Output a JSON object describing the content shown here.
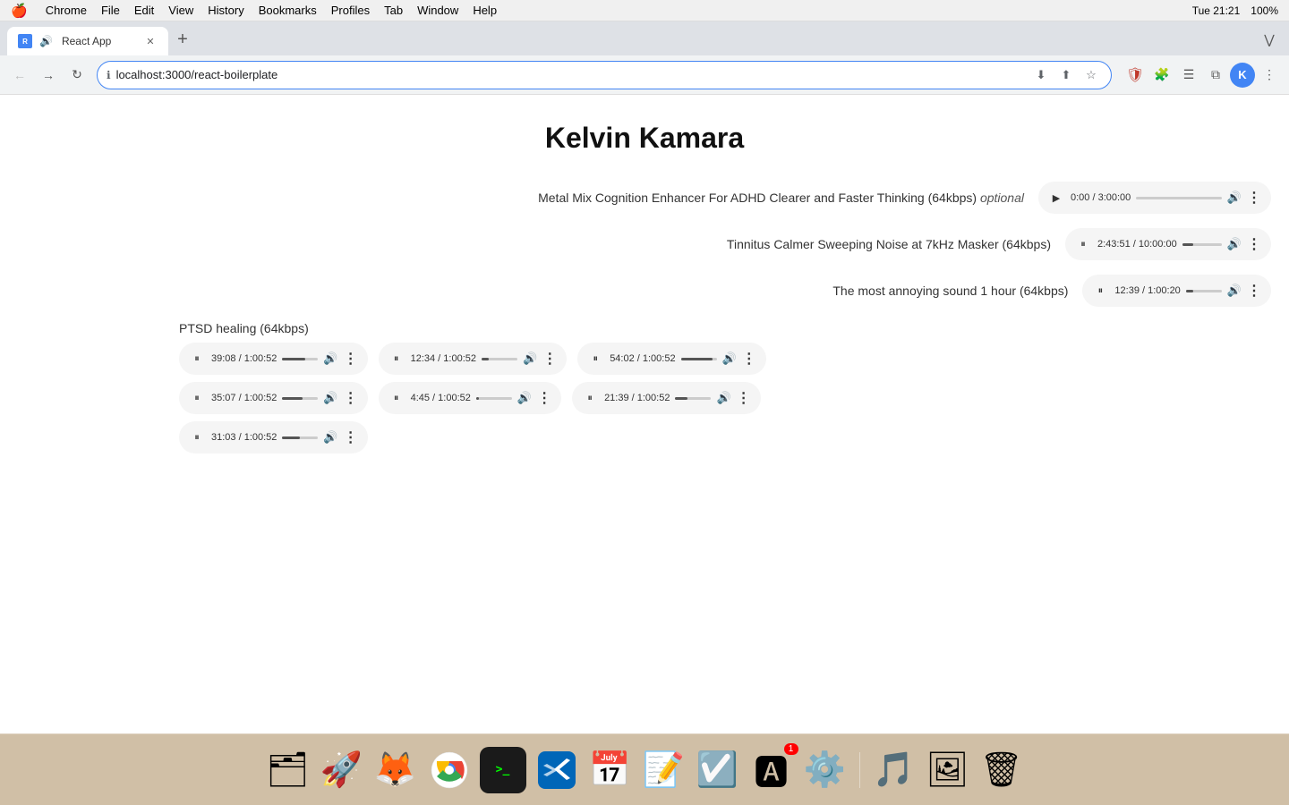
{
  "menubar": {
    "apple": "🍎",
    "items": [
      "Chrome",
      "File",
      "Edit",
      "View",
      "History",
      "Bookmarks",
      "Profiles",
      "Tab",
      "Window",
      "Help"
    ],
    "right": {
      "time": "Tue 21:21",
      "battery": "100%"
    }
  },
  "tab": {
    "title": "React App",
    "favicon_letter": "R",
    "url": "localhost:3000/react-boilerplate"
  },
  "page": {
    "title": "Kelvin Kamara",
    "sections": [
      {
        "id": "section1",
        "label": "Metal Mix Cognition Enhancer For ADHD Clearer and Faster Thinking (64kbps)",
        "label_suffix": "optional",
        "players": [
          {
            "state": "paused",
            "current": "0:00",
            "total": "3:00:00",
            "progress_pct": 0
          }
        ]
      },
      {
        "id": "section2",
        "label": "Tinnitus Calmer Sweeping Noise at 7kHz Masker (64kbps)",
        "players": [
          {
            "state": "playing",
            "current": "2:43:51",
            "total": "10:00:00",
            "progress_pct": 27
          }
        ]
      },
      {
        "id": "section3",
        "label": "The most annoying sound 1 hour (64kbps)",
        "players": [
          {
            "state": "playing",
            "current": "12:39",
            "total": "1:00:20",
            "progress_pct": 21
          }
        ]
      },
      {
        "id": "section4",
        "label": "PTSD healing (64kbps)",
        "players": [
          {
            "state": "playing",
            "current": "39:08",
            "total": "1:00:52",
            "progress_pct": 64
          },
          {
            "state": "playing",
            "current": "12:34",
            "total": "1:00:52",
            "progress_pct": 20
          },
          {
            "state": "playing",
            "current": "54:02",
            "total": "1:00:52",
            "progress_pct": 88
          },
          {
            "state": "playing",
            "current": "35:07",
            "total": "1:00:52",
            "progress_pct": 57
          },
          {
            "state": "playing",
            "current": "4:45",
            "total": "1:00:52",
            "progress_pct": 8
          },
          {
            "state": "playing",
            "current": "21:39",
            "total": "1:00:52",
            "progress_pct": 35
          },
          {
            "state": "playing",
            "current": "31:03",
            "total": "1:00:52",
            "progress_pct": 50
          }
        ]
      }
    ]
  },
  "dock": {
    "items": [
      {
        "name": "Finder",
        "icon": "🗂",
        "badge": null
      },
      {
        "name": "Launchpad",
        "icon": "🚀",
        "badge": null
      },
      {
        "name": "Firefox",
        "icon": "🦊",
        "badge": null
      },
      {
        "name": "Chrome",
        "icon": "◎",
        "badge": null
      },
      {
        "name": "Terminal",
        "icon": ">_",
        "badge": null
      },
      {
        "name": "VSCode",
        "icon": "⌨",
        "badge": null
      },
      {
        "name": "Calendar",
        "icon": "📅",
        "badge": null
      },
      {
        "name": "Notes",
        "icon": "📝",
        "badge": null
      },
      {
        "name": "Reminders",
        "icon": "☑",
        "badge": null
      },
      {
        "name": "AppStore",
        "icon": "🅰",
        "badge": "1"
      },
      {
        "name": "Settings",
        "icon": "⚙",
        "badge": null
      },
      {
        "name": "Music",
        "icon": "🎵",
        "badge": null
      },
      {
        "name": "Photos",
        "icon": "🖼",
        "badge": null
      },
      {
        "name": "Trash",
        "icon": "🗑",
        "badge": null
      }
    ]
  },
  "labels": {
    "play": "▶",
    "pause": "⏸",
    "volume": "🔊",
    "more": "⋮"
  }
}
